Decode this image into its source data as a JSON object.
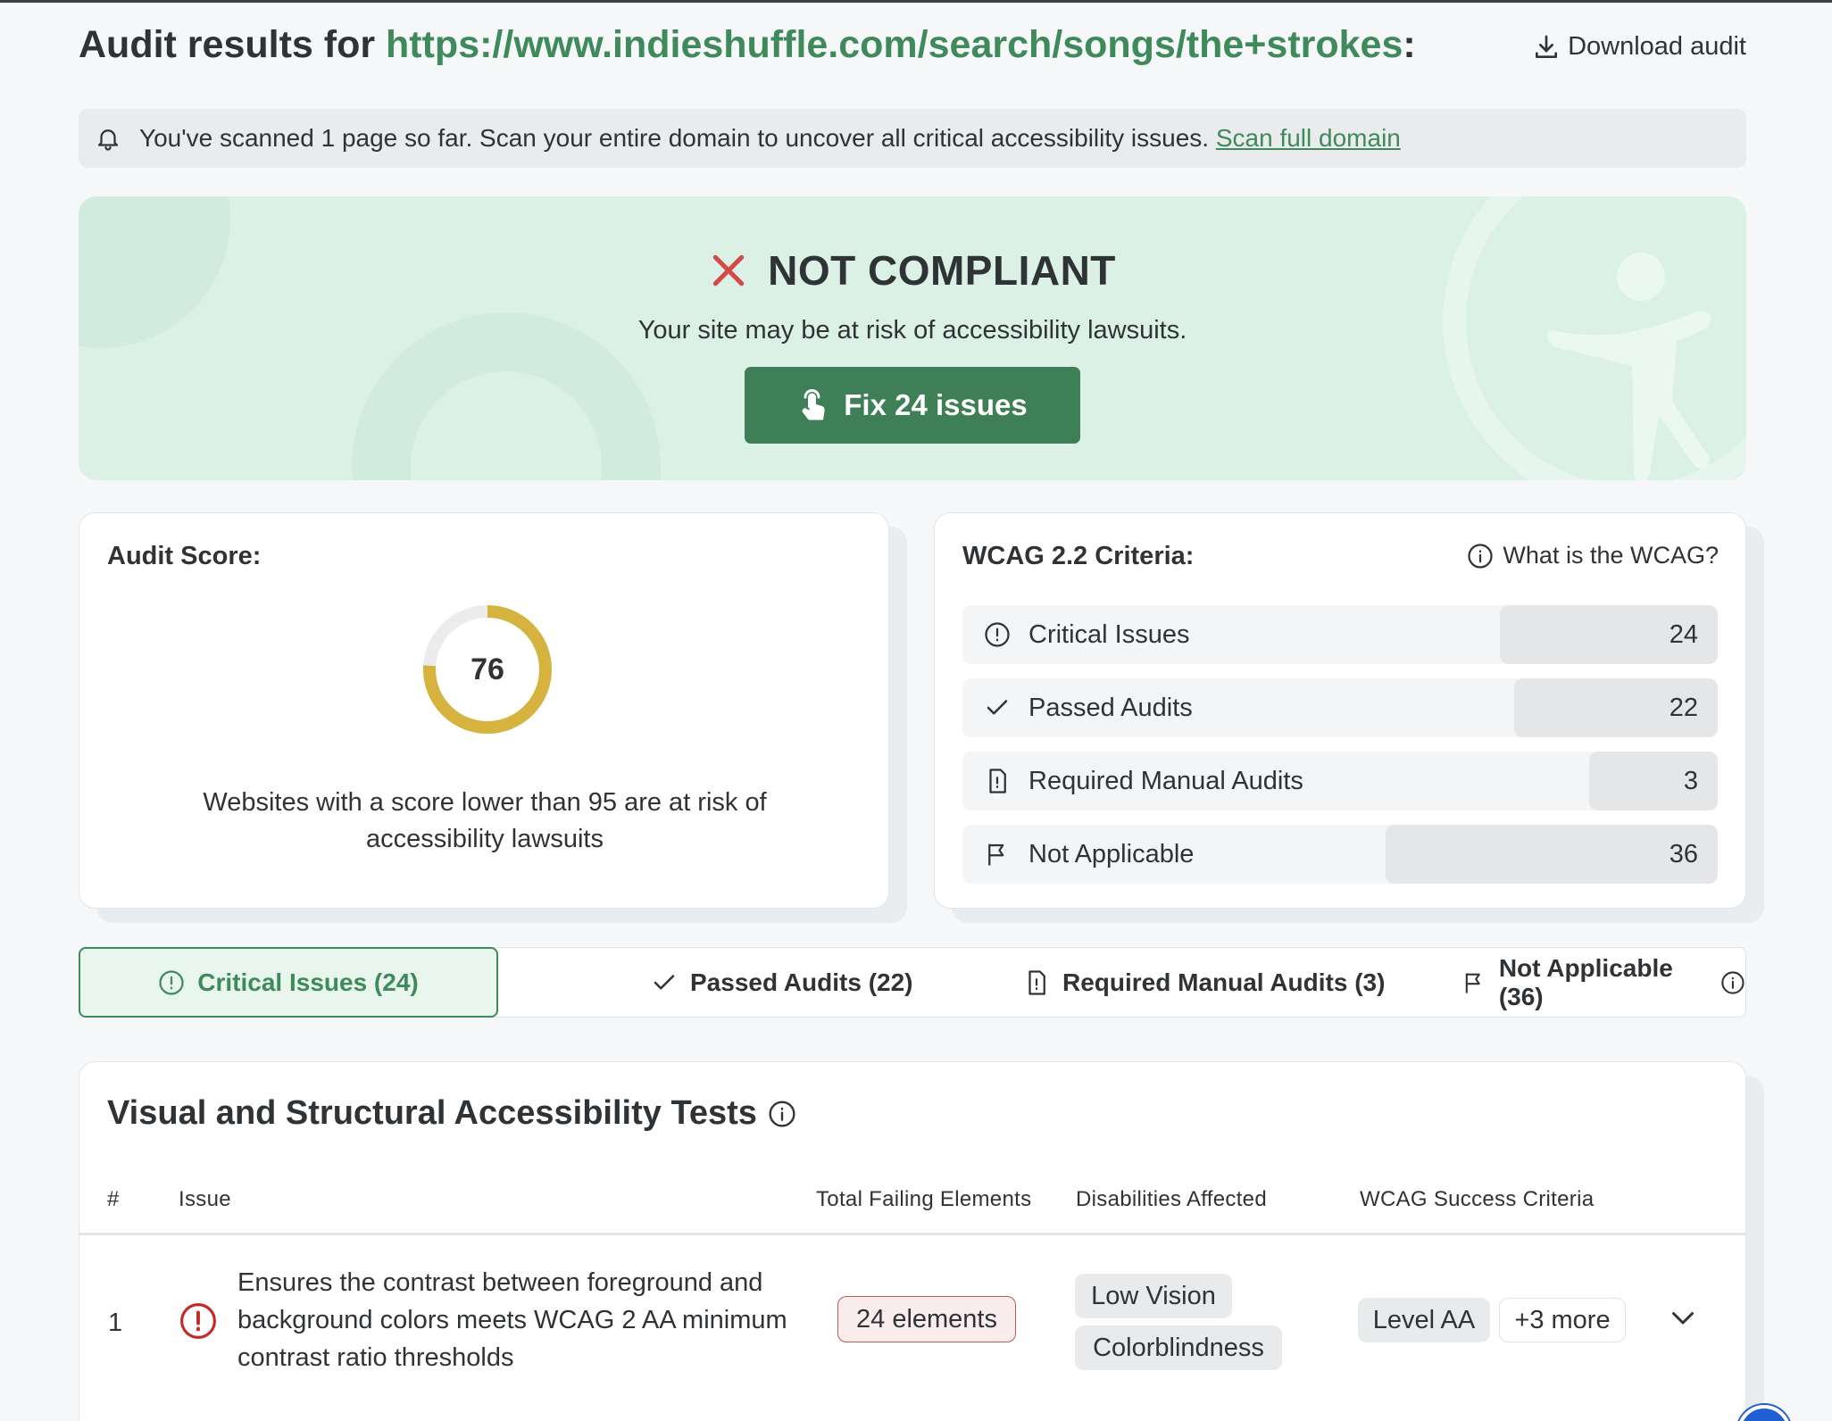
{
  "header": {
    "title_prefix": "Audit results for ",
    "url": "https://www.indieshuffle.com/search/songs/the+strokes",
    "title_suffix": ":",
    "download_label": "Download audit"
  },
  "notice": {
    "text": "You've scanned 1 page so far. Scan your entire domain to uncover all critical accessibility issues.",
    "link": "Scan full domain"
  },
  "hero": {
    "status": "NOT COMPLIANT",
    "risk_text": "Your site may be at risk of accessibility lawsuits.",
    "fix_button": "Fix 24 issues"
  },
  "score": {
    "title": "Audit Score:",
    "value": 76,
    "max": 100,
    "note": "Websites with a score lower than 95 are at risk of accessibility lawsuits",
    "color": "#d6b23f"
  },
  "wcag": {
    "title": "WCAG 2.2 Criteria:",
    "info_link": "What is the WCAG?",
    "rows": [
      {
        "label": "Critical Issues",
        "count": "24",
        "icon": "alert-circle-icon"
      },
      {
        "label": "Passed Audits",
        "count": "22",
        "icon": "check-icon"
      },
      {
        "label": "Required Manual Audits",
        "count": "3",
        "icon": "document-alert-icon"
      },
      {
        "label": "Not Applicable",
        "count": "36",
        "icon": "flag-icon"
      }
    ]
  },
  "tabs": [
    {
      "label": "Critical Issues (24)",
      "icon": "alert-circle-icon",
      "active": true
    },
    {
      "label": "Passed Audits (22)",
      "icon": "check-icon",
      "active": false
    },
    {
      "label": "Required Manual Audits (3)",
      "icon": "document-alert-icon",
      "active": false
    },
    {
      "label": "Not Applicable (36)",
      "icon": "flag-icon",
      "active": false
    }
  ],
  "tests": {
    "title": "Visual and Structural Accessibility Tests",
    "columns": [
      "#",
      "Issue",
      "Total Failing Elements",
      "Disabilities Affected",
      "WCAG Success Criteria"
    ],
    "rows": [
      {
        "num": "1",
        "issue": "Ensures the contrast between foreground and background colors meets WCAG 2 AA minimum contrast ratio thresholds",
        "failing": "24 elements",
        "disabilities": [
          "Low Vision",
          "Colorblindness"
        ],
        "level": "Level AA",
        "more": "+3 more"
      }
    ]
  },
  "colors": {
    "brand_green": "#3f8a5b",
    "button_green": "#3e7f57",
    "error_red": "#c62828",
    "gauge_gold": "#d6b23f"
  }
}
